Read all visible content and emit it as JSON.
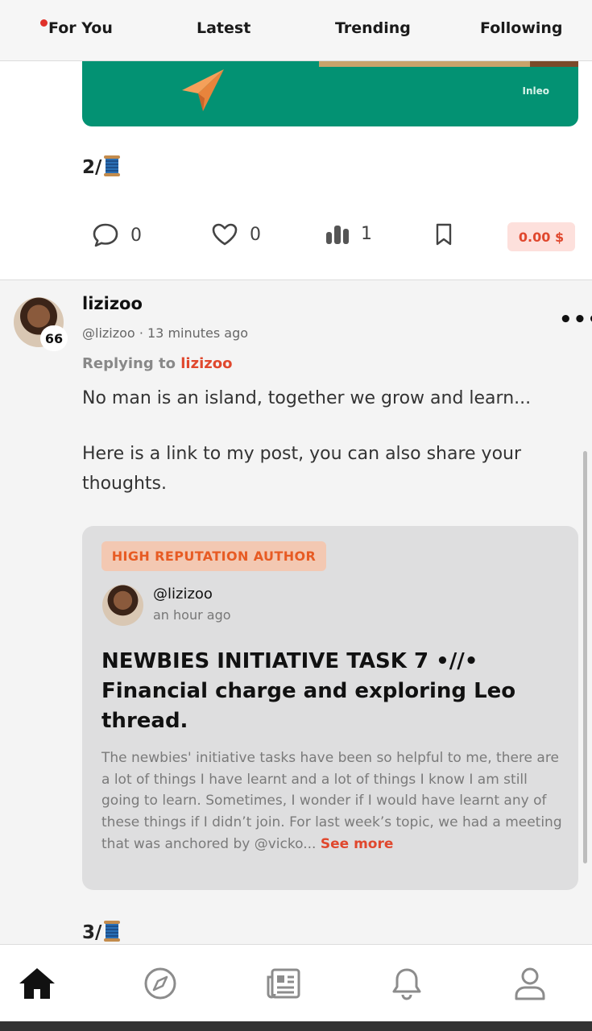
{
  "tabs": [
    {
      "label": "For You",
      "active": true,
      "has_notification_dot": true
    },
    {
      "label": "Latest"
    },
    {
      "label": "Trending"
    },
    {
      "label": "Following"
    }
  ],
  "previous_post": {
    "media_logo_text": "Inleo",
    "thread_index": "2/",
    "thread_index_icon": "spool-of-thread-emoji",
    "actions": {
      "comments": "0",
      "likes": "0",
      "views": "1",
      "bookmark_icon": "bookmark-icon",
      "payout": "0.00 $"
    }
  },
  "reply_post": {
    "author_name": "lizizoo",
    "reputation": "66",
    "handle": "@lizizoo",
    "separator": "·",
    "time": "13 minutes ago",
    "replying_prefix": "Replying to",
    "replying_to": "lizizoo",
    "paragraph_1": "No man is an island, together we grow and learn...",
    "paragraph_2": "Here is a link to my post, you can also share your thoughts.",
    "embedded_card": {
      "badge": "HIGH REPUTATION AUTHOR",
      "handle": "@lizizoo",
      "time": "an hour ago",
      "title": "NEWBIES INITIATIVE TASK 7 •//• Financial charge and exploring Leo thread.",
      "excerpt": "The newbies' initiative tasks have been so helpful to me, there are a lot of things I have learnt and a lot of things I know I am still going to learn. Sometimes, I wonder if I would have learnt any of these things if I didn’t join. For last week’s topic, we had a meeting that was anchored by @vicko...",
      "see_more": "See more"
    },
    "thread_index": "3/"
  },
  "bottom_nav": [
    {
      "icon": "home-icon",
      "active": true
    },
    {
      "icon": "compass-icon"
    },
    {
      "icon": "newspaper-icon"
    },
    {
      "icon": "bell-icon"
    },
    {
      "icon": "profile-icon"
    }
  ],
  "colors": {
    "accent": "#e0482e",
    "badge_bg": "#f3c8b2",
    "media_bg": "#039273",
    "card_bg": "#dededf"
  }
}
